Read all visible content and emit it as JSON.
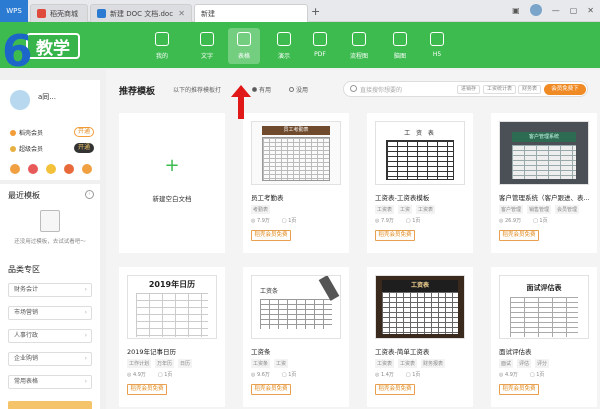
{
  "titlebar": {
    "app": "WPS",
    "tabs": [
      {
        "label": "稻壳商城",
        "icon": "docer-icon",
        "color": "#e04a3c"
      },
      {
        "label": "新建 DOC 文档.doc",
        "icon": "doc-icon",
        "color": "#2b7bd3"
      },
      {
        "label": "新建",
        "icon": "new-icon",
        "color": "#ffffff"
      }
    ]
  },
  "brand": {
    "label": "教学",
    "big_number": "6"
  },
  "nav": [
    {
      "label": "我的",
      "icon": "my-icon"
    },
    {
      "label": "文字",
      "icon": "text-icon"
    },
    {
      "label": "表格",
      "icon": "table-icon"
    },
    {
      "label": "演示",
      "icon": "slides-icon"
    },
    {
      "label": "PDF",
      "icon": "pdf-icon"
    },
    {
      "label": "流程图",
      "icon": "flowchart-icon"
    },
    {
      "label": "脑图",
      "icon": "mindmap-icon"
    },
    {
      "label": "H5",
      "icon": "h5-icon"
    }
  ],
  "user": {
    "name": "a同...",
    "vip1": "稻壳会员",
    "vip1_btn": "开通",
    "vip2": "超级会员",
    "vip2_btn": "开通"
  },
  "recent": {
    "title": "最近模板",
    "empty_text": "还没用过模板，去试试看吧～"
  },
  "categories": {
    "title": "品类专区",
    "items": [
      "财务会计",
      "市场营销",
      "人事行政",
      "企业购销",
      "常用表格"
    ]
  },
  "main": {
    "title": "推荐模板",
    "filter_all": "以下的推荐模板打",
    "filter_paid": "有用",
    "filter_free": "没用",
    "search_placeholder": "直接搜你想要的",
    "search_tags": [
      "进销存",
      "工资统计表",
      "财务表"
    ],
    "vip_free": "会员免费下"
  },
  "templates": [
    {
      "blank": true,
      "label": "新建空白文档"
    },
    {
      "name": "员工考勤表",
      "tags": [
        "考勤表"
      ],
      "views": "7.9万",
      "pages": "1页",
      "btn": "稻壳会员免费",
      "thumb_text": "员工考勤表"
    },
    {
      "name": "工资表-工资表模板",
      "tags": [
        "工资表",
        "工资",
        "工资表"
      ],
      "views": "7.9万",
      "pages": "1页",
      "btn": "稻壳会员免费",
      "thumb_text": "工  资  表"
    },
    {
      "name": "客户管理系统（客户跟进、表...",
      "tags": [
        "客户管理",
        "销售管理",
        "会员管理"
      ],
      "views": "26.9万",
      "pages": "1页",
      "btn": "稻壳会员免费",
      "thumb_text": "客户管理系统"
    },
    {
      "name": "2019年记事日历",
      "tags": [
        "工作计划",
        "万年历",
        "日历"
      ],
      "views": "4.9万",
      "pages": "1页",
      "btn": "稻壳会员免费",
      "thumb_text": "2019年日历"
    },
    {
      "name": "工资条",
      "tags": [
        "工资条",
        "工资"
      ],
      "views": "9.6万",
      "pages": "1页",
      "btn": "稻壳会员免费",
      "thumb_text": "工资条"
    },
    {
      "name": "工资表-简单工资表",
      "tags": [
        "工资表",
        "工资表",
        "财务报表"
      ],
      "views": "1.4万",
      "pages": "1页",
      "btn": "稻壳会员免费",
      "thumb_text": "工资表"
    },
    {
      "name": "面试评估表",
      "tags": [
        "面试",
        "评估",
        "评分"
      ],
      "views": "4.9万",
      "pages": "1页",
      "btn": "稻壳会员免费",
      "thumb_text": "面试评估表"
    }
  ]
}
